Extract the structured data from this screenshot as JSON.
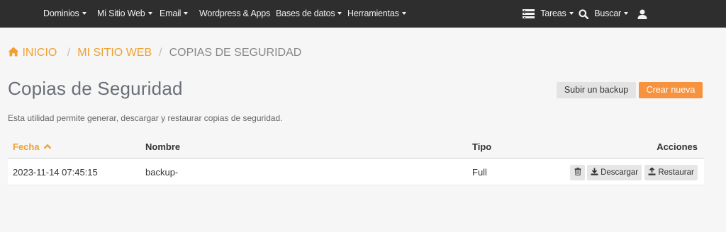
{
  "topnav": {
    "items": [
      {
        "label": "Dominios"
      },
      {
        "label": "Mi Sitio Web"
      },
      {
        "label": "Email"
      },
      {
        "label": "Wordpress & Apps"
      },
      {
        "label": "Bases de datos"
      },
      {
        "label": "Herramientas"
      }
    ],
    "tasks_label": "Tareas",
    "search_label": "Buscar"
  },
  "breadcrumb": {
    "home": "INICIO",
    "site": "MI SITIO WEB",
    "current": "COPIAS DE SEGURIDAD"
  },
  "page": {
    "title": "Copias de Seguridad",
    "description": "Esta utilidad permite generar, descargar y restaurar copias de seguridad.",
    "upload_button": "Subir un backup",
    "create_button": "Crear nueva"
  },
  "table": {
    "headers": {
      "date": "Fecha",
      "name": "Nombre",
      "type": "Tipo",
      "actions": "Acciones"
    },
    "rows": [
      {
        "date": "2023-11-14 07:45:15",
        "name": "backup-",
        "type": "Full"
      }
    ],
    "download_label": "Descargar",
    "restore_label": "Restaurar"
  },
  "colors": {
    "accent": "#f7923f",
    "link": "#f0a030",
    "navbar": "#2e2e2e"
  }
}
